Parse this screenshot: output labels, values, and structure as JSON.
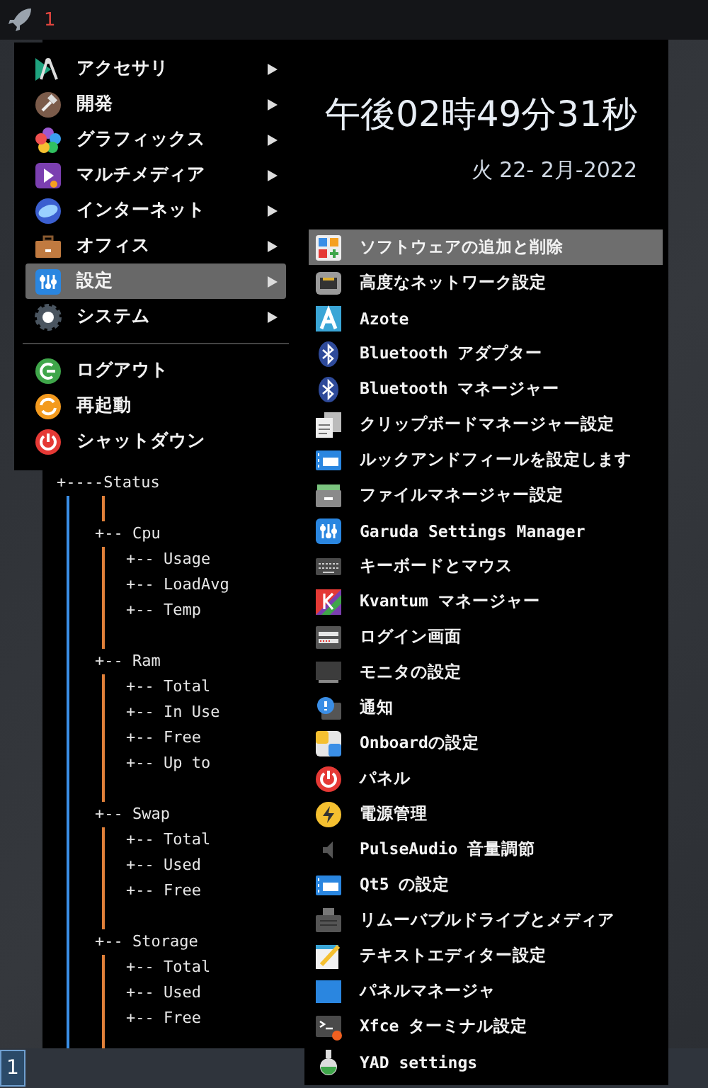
{
  "top_bar": {
    "workspace": "1"
  },
  "main_menu": {
    "categories": [
      {
        "label": "アクセサリ",
        "selected": false
      },
      {
        "label": "開発",
        "selected": false
      },
      {
        "label": "グラフィックス",
        "selected": false
      },
      {
        "label": "マルチメディア",
        "selected": false
      },
      {
        "label": "インターネット",
        "selected": false
      },
      {
        "label": "オフィス",
        "selected": false
      },
      {
        "label": "設定",
        "selected": true
      },
      {
        "label": "システム",
        "selected": false
      }
    ],
    "session_actions": [
      {
        "label": "ログアウト"
      },
      {
        "label": "再起動"
      },
      {
        "label": "シャットダウン"
      }
    ]
  },
  "clock": {
    "time": "午後02時49分31秒",
    "date": "火 22- 2月-2022"
  },
  "settings_submenu": [
    {
      "label": "ソフトウェアの追加と削除",
      "selected": true
    },
    {
      "label": "高度なネットワーク設定",
      "selected": false
    },
    {
      "label": "Azote",
      "selected": false
    },
    {
      "label": "Bluetooth アダプター",
      "selected": false
    },
    {
      "label": "Bluetooth マネージャー",
      "selected": false
    },
    {
      "label": "クリップボードマネージャー設定",
      "selected": false
    },
    {
      "label": "ルックアンドフィールを設定します",
      "selected": false
    },
    {
      "label": "ファイルマネージャー設定",
      "selected": false
    },
    {
      "label": "Garuda Settings Manager",
      "selected": false
    },
    {
      "label": "キーボードとマウス",
      "selected": false
    },
    {
      "label": "Kvantum マネージャー",
      "selected": false
    },
    {
      "label": "ログイン画面",
      "selected": false
    },
    {
      "label": "モニタの設定",
      "selected": false
    },
    {
      "label": "通知",
      "selected": false
    },
    {
      "label": "Onboardの設定",
      "selected": false
    },
    {
      "label": "パネル",
      "selected": false
    },
    {
      "label": "電源管理",
      "selected": false
    },
    {
      "label": "PulseAudio 音量調節",
      "selected": false
    },
    {
      "label": "Qt5 の設定",
      "selected": false
    },
    {
      "label": "リムーバブルドライブとメディア",
      "selected": false
    },
    {
      "label": "テキストエディター設定",
      "selected": false
    },
    {
      "label": "パネルマネージャ",
      "selected": false
    },
    {
      "label": "Xfce ターミナル設定",
      "selected": false
    },
    {
      "label": "YAD settings",
      "selected": false
    }
  ],
  "conky_tree": {
    "label": "+----Status",
    "children": [
      {
        "label": "+-- Cpu",
        "children": [
          {
            "label": "+-- Usage"
          },
          {
            "label": "+-- LoadAvg"
          },
          {
            "label": "+-- Temp"
          }
        ]
      },
      {
        "label": "+-- Ram",
        "children": [
          {
            "label": "+-- Total"
          },
          {
            "label": "+-- In Use"
          },
          {
            "label": "+-- Free"
          },
          {
            "label": "+-- Up to"
          }
        ]
      },
      {
        "label": "+-- Swap",
        "children": [
          {
            "label": "+-- Total"
          },
          {
            "label": "+-- Used"
          },
          {
            "label": "+-- Free"
          }
        ]
      },
      {
        "label": "+-- Storage",
        "children": [
          {
            "label": "+-- Total"
          },
          {
            "label": "+-- Used"
          },
          {
            "label": "+-- Free"
          }
        ]
      }
    ]
  },
  "taskbar": {
    "workspace": "1"
  }
}
